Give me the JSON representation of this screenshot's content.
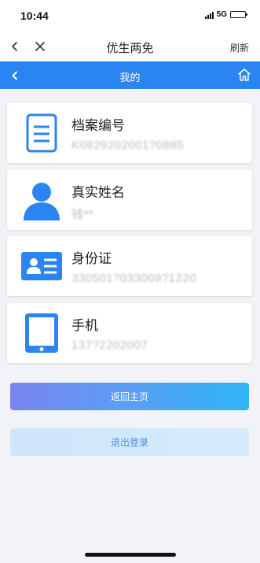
{
  "status_bar": {
    "time": "10:44",
    "network": "5G"
  },
  "nav": {
    "title": "优生两免",
    "refresh_label": "刷新"
  },
  "header": {
    "title": "我的"
  },
  "cards": [
    {
      "label": "档案编号",
      "value": "K0829202001?0885",
      "icon": "document-icon"
    },
    {
      "label": "真实姓名",
      "value": "钱**",
      "icon": "person-icon"
    },
    {
      "label": "身份证",
      "value": "330501?033009?1220",
      "icon": "id-card-icon"
    },
    {
      "label": "手机",
      "value": "137?2202007",
      "icon": "tablet-icon"
    }
  ],
  "buttons": {
    "home_label": "返回主页",
    "logout_label": "退出登录"
  },
  "colors": {
    "accent": "#2a84f2",
    "icon_blue": "#2a84f2",
    "page_bg": "#f1f3f6"
  }
}
